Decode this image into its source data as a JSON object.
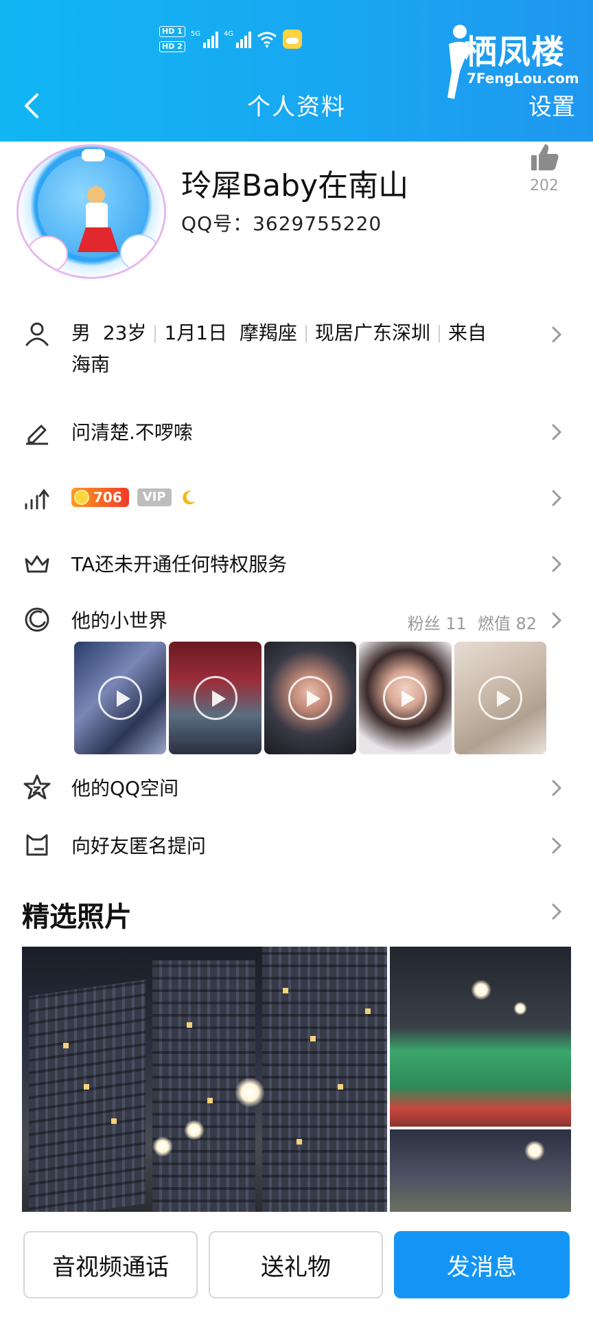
{
  "header": {
    "title": "个人资料",
    "settings_label": "设置",
    "status_bar": {
      "hd1": "HD 1",
      "hd2": "HD 2",
      "sim1_network": "5G",
      "sim2_network": "4G"
    },
    "watermark": {
      "chinese": "栖凤楼",
      "english": "7FengLou.com"
    }
  },
  "profile": {
    "nickname": "玲犀Baby在南山",
    "qq_number": "QQ号：3629755220",
    "like_count": "202"
  },
  "info": {
    "gender": "男",
    "age": "23岁",
    "birthday": "1月1日",
    "zodiac": "摩羯座",
    "residence": "现居广东深圳",
    "hometown_prefix": "来自",
    "hometown": "海南"
  },
  "signature": "问清楚.不啰嗦",
  "level": {
    "value": "706",
    "vip_label": "VIP"
  },
  "privilege": "TA还未开通任何特权服务",
  "small_world": {
    "title": "他的小世界",
    "fans": "粉丝 11",
    "heat": "燃值 82",
    "video_count": 5
  },
  "qzone": "他的QQ空间",
  "anonymous_question": "向好友匿名提问",
  "photos": {
    "title": "精选照片"
  },
  "actions": {
    "call": "音视频通话",
    "gift": "送礼物",
    "message": "发消息"
  },
  "colors": {
    "header_bg": "#19a6f2",
    "primary_button": "#1495f5",
    "level_badge": "#f03a2a",
    "secondary_text": "#9a9a9a"
  },
  "icons": [
    "back-icon",
    "like-icon",
    "user-icon",
    "pencil-icon",
    "level-chart-icon",
    "crown-icon",
    "small-world-icon",
    "qzone-star-icon",
    "anonymous-question-icon",
    "chevron-right-icon",
    "play-icon",
    "moon-icon",
    "wifi-icon",
    "weather-icon"
  ]
}
